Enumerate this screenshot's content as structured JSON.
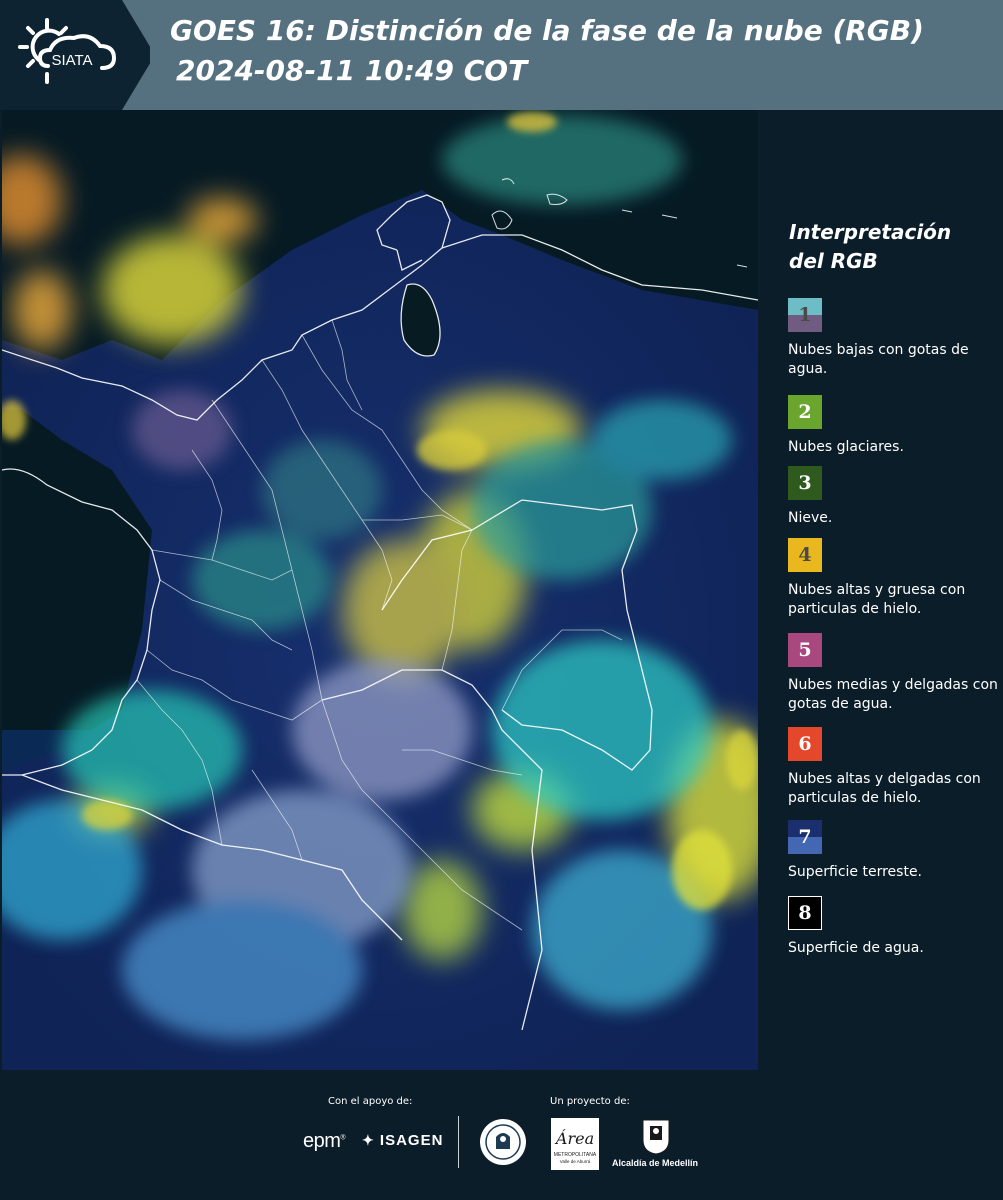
{
  "header": {
    "logo_text": "SIATA",
    "title": "GOES 16: Distinción de la fase de la nube (RGB)",
    "subtitle": "2024-08-11 10:49 COT"
  },
  "map": {
    "description_icon": "satellite-rgb-map-colombia"
  },
  "legend": {
    "title": "Interpretación del RGB",
    "items": [
      {
        "number": "1",
        "label": "Nubes bajas con gotas de agua.",
        "colors": [
          "#6dbdc7",
          "#6f5c80"
        ],
        "number_color": "#4a4a4a"
      },
      {
        "number": "2",
        "label": "Nubes glaciares.",
        "colors": [
          "#6aa62e"
        ],
        "number_color": "#ffffff"
      },
      {
        "number": "3",
        "label": "Nieve.",
        "colors": [
          "#2f5a1e"
        ],
        "number_color": "#ffffff"
      },
      {
        "number": "4",
        "label": "Nubes altas y gruesa con particulas de hielo.",
        "colors": [
          "#e8b81e"
        ],
        "number_color": "#4a4a4a"
      },
      {
        "number": "5",
        "label": "Nubes medias y delgadas con gotas de agua.",
        "colors": [
          "#a9487e"
        ],
        "number_color": "#ffffff"
      },
      {
        "number": "6",
        "label": "Nubes altas y delgadas con particulas de hielo.",
        "colors": [
          "#e4472a"
        ],
        "number_color": "#ffffff"
      },
      {
        "number": "7",
        "label": "Superficie terreste.",
        "colors": [
          "#1b2f6e",
          "#4467b3"
        ],
        "number_color": "#ffffff"
      },
      {
        "number": "8",
        "label": "Superficie de agua.",
        "colors": [
          "#000000"
        ],
        "number_color": "#ffffff"
      }
    ]
  },
  "footer": {
    "support_label": "Con el apoyo de:",
    "project_label": "Un proyecto de:",
    "epm": "epm",
    "isagen": "ISAGEN",
    "area_title": "Área",
    "area_sub1": "METROPOLITANA",
    "area_sub2": "Valle de Aburrá",
    "alcaldia": "Alcaldía de Medellín"
  }
}
